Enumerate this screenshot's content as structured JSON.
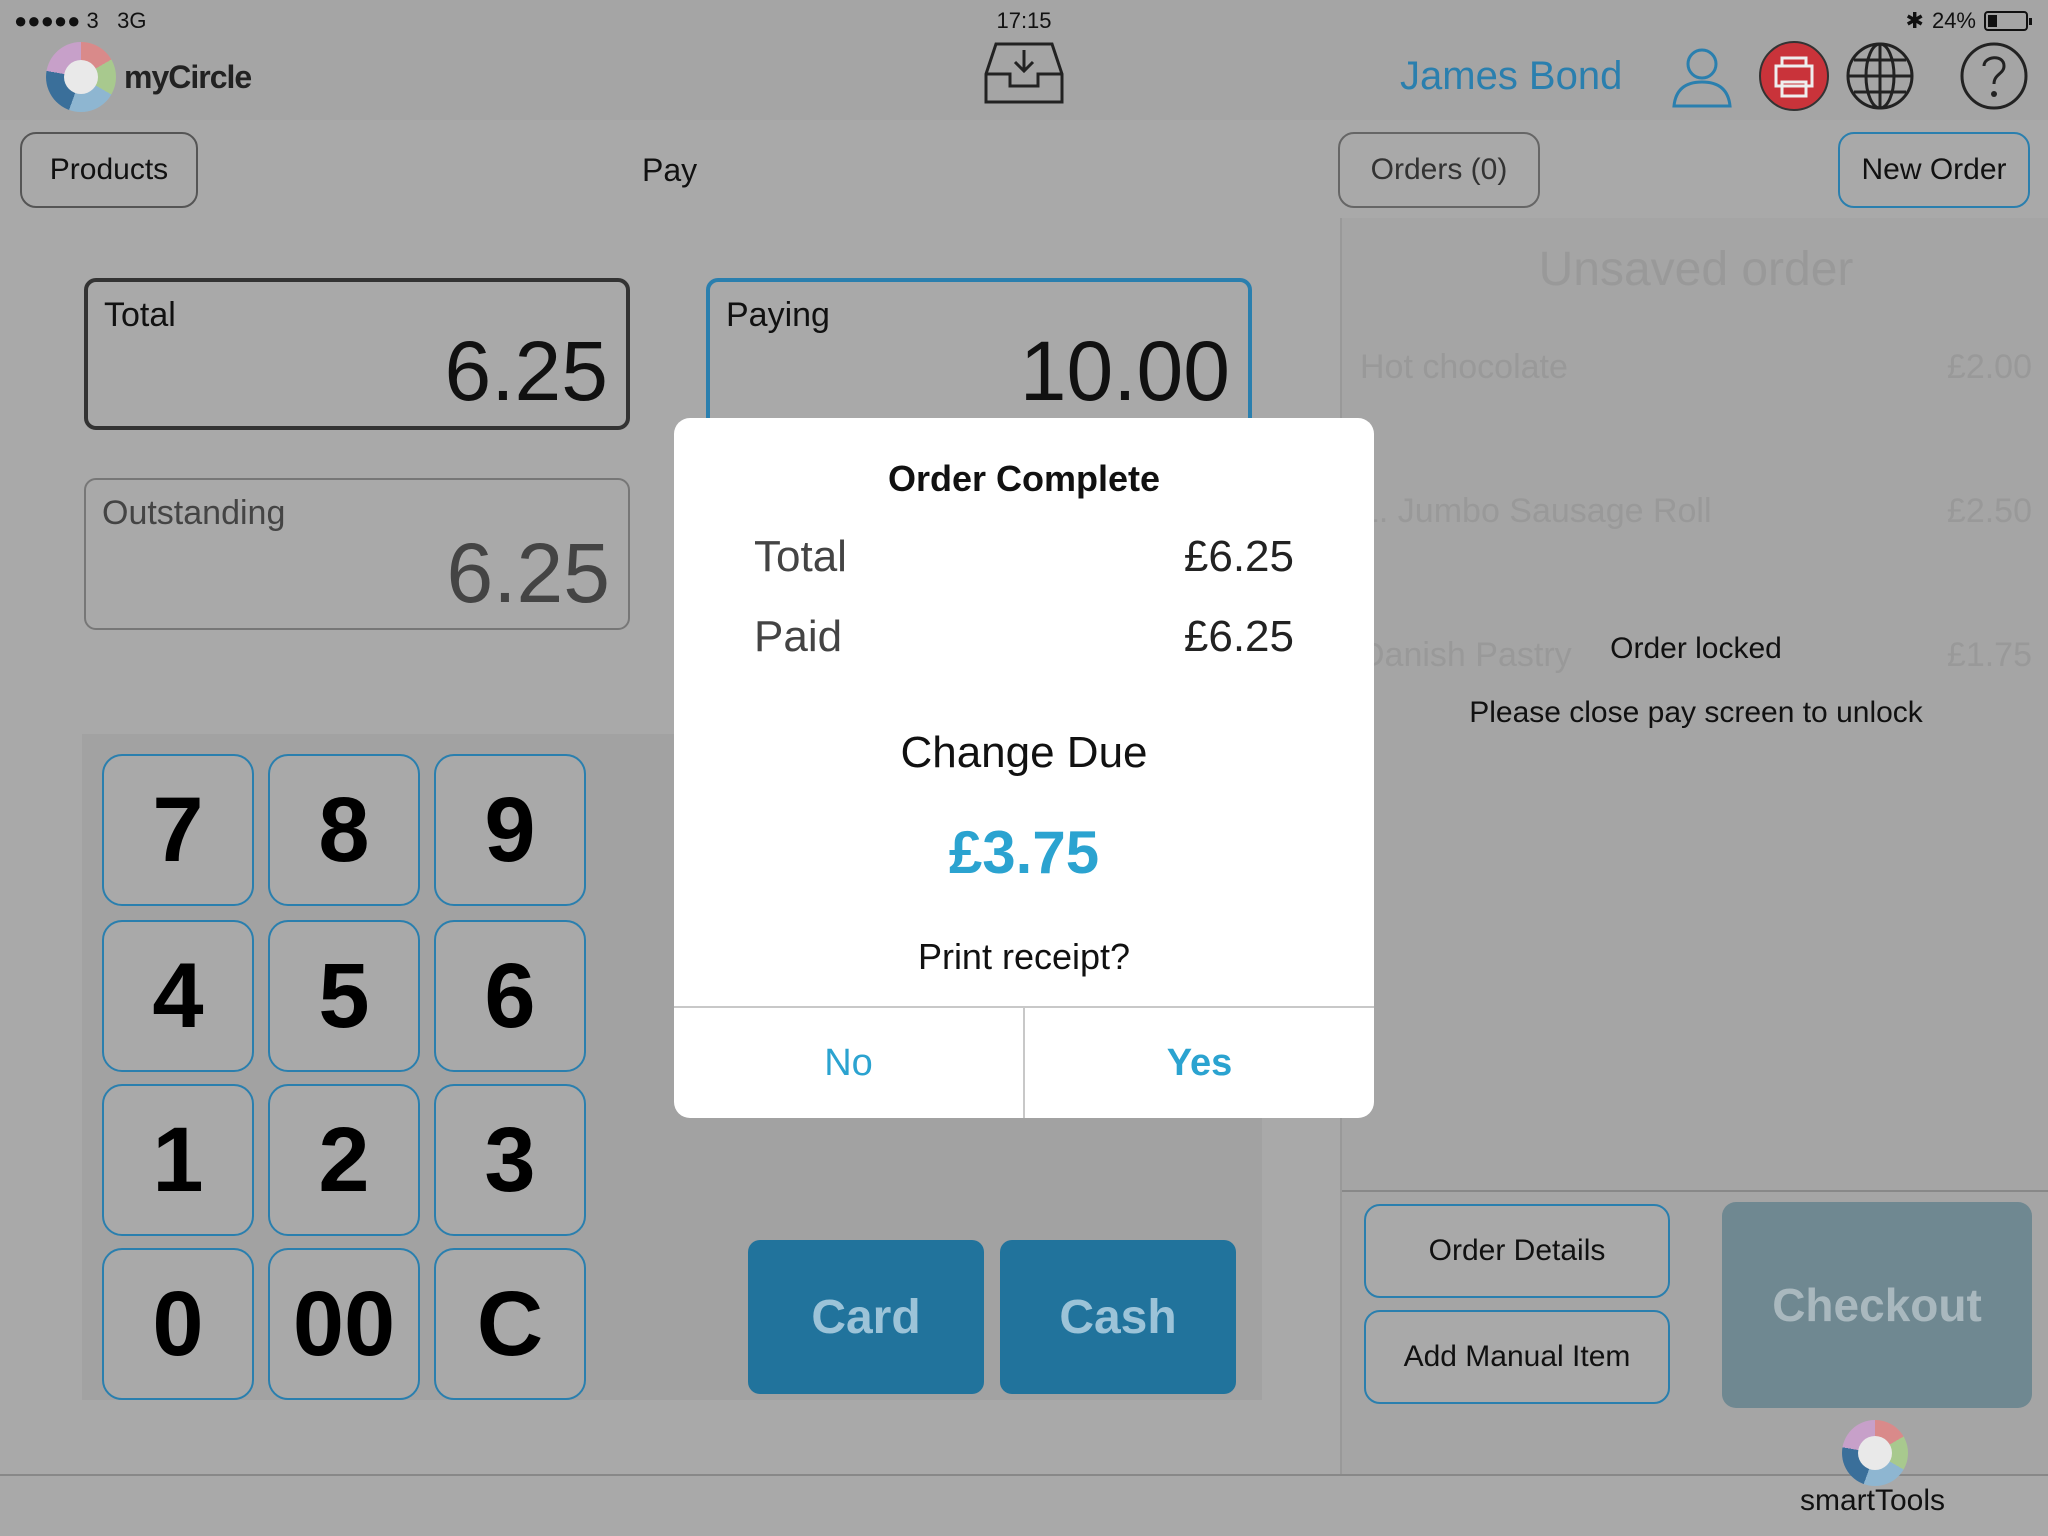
{
  "status_bar": {
    "carrier": "●●●●● 3",
    "network": "3G",
    "time": "17:15",
    "bluetooth": "✱",
    "battery": "24%"
  },
  "header": {
    "app_name": "myCircle",
    "user_name": "James Bond"
  },
  "nav": {
    "products_label": "Products",
    "page_title": "Pay",
    "orders_label": "Orders (0)",
    "new_order_label": "New Order"
  },
  "pay": {
    "total_label": "Total",
    "total_value": "6.25",
    "paying_label": "Paying",
    "paying_value": "10.00",
    "outstanding_label": "Outstanding",
    "outstanding_value": "6.25"
  },
  "keypad": [
    "7",
    "8",
    "9",
    "4",
    "5",
    "6",
    "1",
    "2",
    "3",
    "0",
    "00",
    "C"
  ],
  "pay_buttons": {
    "card": "Card",
    "cash": "Cash"
  },
  "order": {
    "title": "Unsaved order",
    "items": [
      {
        "name": "Hot chocolate",
        "price": "£2.00"
      },
      {
        "name": "1. Jumbo Sausage Roll",
        "price": "£2.50"
      },
      {
        "name": "Danish Pastry",
        "price": "£1.75"
      }
    ],
    "lock_title": "Order locked",
    "lock_message": "Please close pay screen to unlock",
    "order_details_label": "Order Details",
    "add_manual_item_label": "Add Manual Item",
    "checkout_label": "Checkout"
  },
  "footer": {
    "smart_tools_label": "smartTools"
  },
  "modal": {
    "title": "Order Complete",
    "total_label": "Total",
    "total_value": "£6.25",
    "paid_label": "Paid",
    "paid_value": "£6.25",
    "change_label": "Change Due",
    "change_value": "£3.75",
    "print_question": "Print receipt?",
    "no_label": "No",
    "yes_label": "Yes"
  }
}
